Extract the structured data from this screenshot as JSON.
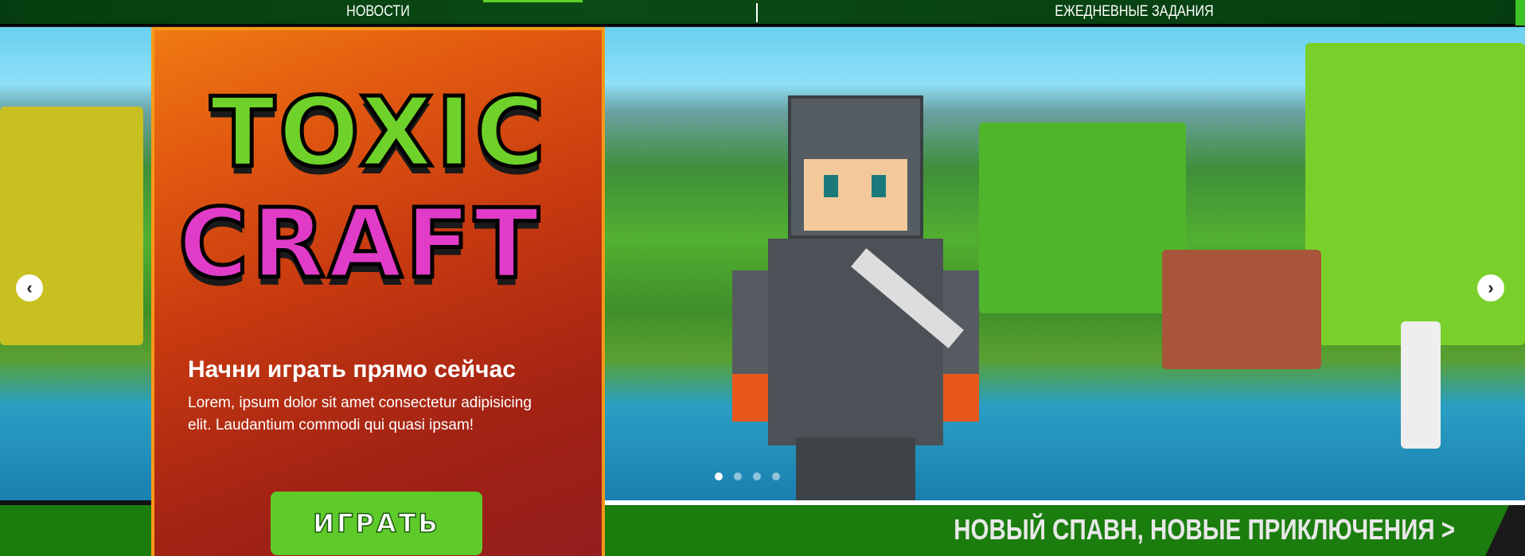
{
  "nav": {
    "items": [
      {
        "label": "НОВОСТИ"
      },
      {
        "label": "ЕЖЕДНЕВНЫЕ ЗАДАНИЯ"
      }
    ]
  },
  "promo": {
    "logo_line1": "TOXIC",
    "logo_line2": "CRAFT",
    "title": "Начни играть прямо сейчас",
    "description": "Lorem, ipsum dolor sit amet consectetur adipisicing elit. Laudantium commodi qui quasi ipsam!",
    "play_label": "ИГРАТЬ"
  },
  "slider": {
    "prev": "‹",
    "next": "›",
    "slide_count": 4,
    "active_slide": 1
  },
  "banner": {
    "link_label": "НОВЫЙ СПАВН, НОВЫЕ ПРИКЛЮЧЕНИЯ >"
  }
}
